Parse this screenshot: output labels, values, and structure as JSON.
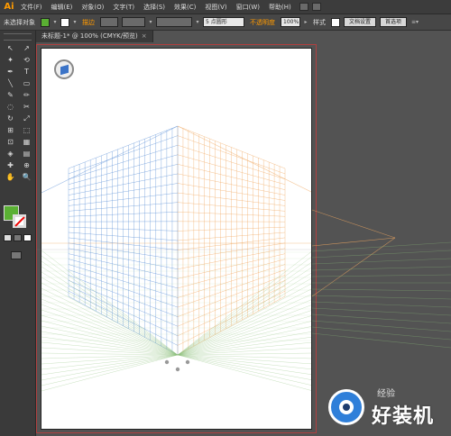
{
  "menubar": {
    "logo": "Ai",
    "items": [
      "文件(F)",
      "编辑(E)",
      "对象(O)",
      "文字(T)",
      "选择(S)",
      "效果(C)",
      "视图(V)",
      "窗口(W)",
      "帮助(H)"
    ]
  },
  "controlbar": {
    "selection_label": "未选择对象",
    "stroke_label": "描边",
    "brush_value": "5 点圆形",
    "opacity_label": "不透明度",
    "opacity_value": "100%",
    "style_label": "样式",
    "doc_setup": "文档设置",
    "preferences": "首选项",
    "fill_color": "#5ab033"
  },
  "tab": {
    "title": "未标题-1* @ 100% (CMYK/预览)",
    "close": "×"
  },
  "toolbar": {
    "tools": [
      "↖",
      "↗",
      "✦",
      "⟲",
      "✒",
      "T",
      "╲",
      "▭",
      "✎",
      "✏",
      "◌",
      "✂",
      "↻",
      "⤢",
      "⊞",
      "⬚",
      "⊡",
      "▦",
      "◈",
      "▤",
      "✚",
      "⊕",
      "✋",
      "🔍"
    ]
  },
  "watermark": {
    "text": "好装机",
    "small": "经验"
  },
  "colors": {
    "left_grid": "#5b8fd6",
    "right_grid": "#f0a860",
    "ground_grid": "#8bbf7a",
    "horizon": "#f0a860"
  }
}
